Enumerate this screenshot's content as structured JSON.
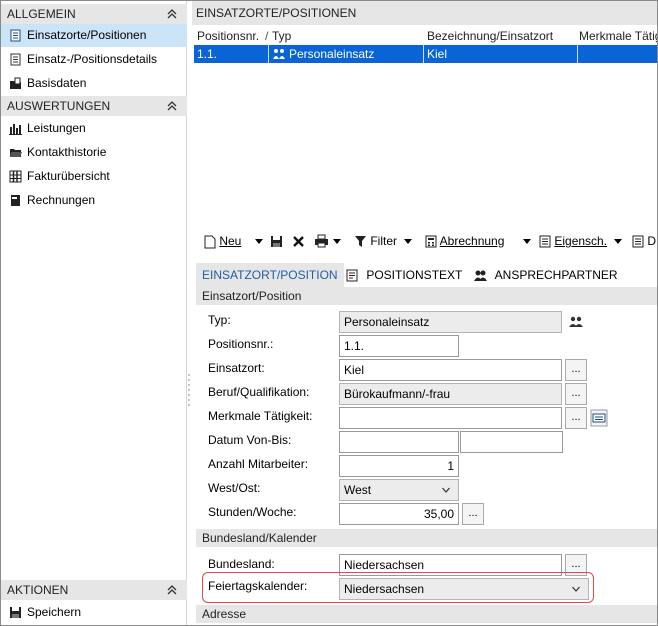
{
  "left_panel": {
    "sections": [
      {
        "header": "ALLGEMEIN",
        "items": [
          {
            "label": "Einsatzorte/Positionen",
            "icon": "document-icon",
            "selected": true
          },
          {
            "label": "Einsatz-/Positionsdetails",
            "icon": "list-document-icon",
            "selected": false
          },
          {
            "label": "Basisdaten",
            "icon": "folder-document-icon",
            "selected": false
          }
        ]
      },
      {
        "header": "AUSWERTUNGEN",
        "items": [
          {
            "label": "Leistungen",
            "icon": "bar-chart-icon",
            "selected": false
          },
          {
            "label": "Kontakthistorie",
            "icon": "folder-icon",
            "selected": false
          },
          {
            "label": "Fakturübersicht",
            "icon": "table-grid-icon",
            "selected": false
          },
          {
            "label": "Rechnungen",
            "icon": "invoice-icon",
            "selected": false
          }
        ]
      },
      {
        "header": "AKTIONEN",
        "items": [
          {
            "label": "Speichern",
            "icon": "save-icon",
            "selected": false
          }
        ]
      }
    ]
  },
  "grid": {
    "title": "EINSATZORTE/POSITIONEN",
    "columns": [
      "Positionsnr.",
      "Typ",
      "Bezeichnung/Einsatzort",
      "Merkmale Tätig"
    ],
    "sort_indicator": "/",
    "rows": [
      {
        "positionsnr": "1.1.",
        "typ": "Personaleinsatz",
        "bezeichnung": "Kiel",
        "merkmale": ""
      }
    ]
  },
  "toolbar": {
    "new_label": "Neu",
    "filter_label": "Filter",
    "abrechnung_label": "Abrechnung",
    "eigensch_label": "Eigensch.",
    "d_label": "D"
  },
  "tabs": [
    {
      "label": "EINSATZORT/POSITION",
      "active": true
    },
    {
      "label": "POSITIONSTEXT",
      "active": false
    },
    {
      "label": "ANSPRECHPARTNER",
      "active": false
    }
  ],
  "form": {
    "section1": "Einsatzort/Position",
    "typ_label": "Typ:",
    "typ_value": "Personaleinsatz",
    "positionsnr_label": "Positionsnr.:",
    "positionsnr_value": "1.1.",
    "einsatzort_label": "Einsatzort:",
    "einsatzort_value": "Kiel",
    "beruf_label": "Beruf/Qualifikation:",
    "beruf_value": "Bürokaufmann/-frau",
    "merkmale_label": "Merkmale Tätigkeit:",
    "merkmale_value": "",
    "datum_label": "Datum Von-Bis:",
    "datum_von": "",
    "datum_bis": "",
    "anzahl_label": "Anzahl Mitarbeiter:",
    "anzahl_value": "1",
    "westost_label": "West/Ost:",
    "westost_value": "West",
    "stunden_label": "Stunden/Woche:",
    "stunden_value": "35,00",
    "section2": "Bundesland/Kalender",
    "bundesland_label": "Bundesland:",
    "bundesland_value": "Niedersachsen",
    "feiertag_label": "Feiertagskalender:",
    "feiertag_value": "Niedersachsen",
    "section3": "Adresse",
    "dots": "..."
  },
  "colors": {
    "selection_blue": "#0a64d6",
    "nav_selected": "#cce4f7",
    "section_gray": "#e6e6e6",
    "highlight_red": "#e04a4a",
    "active_tab_text": "#1e5fa8"
  }
}
